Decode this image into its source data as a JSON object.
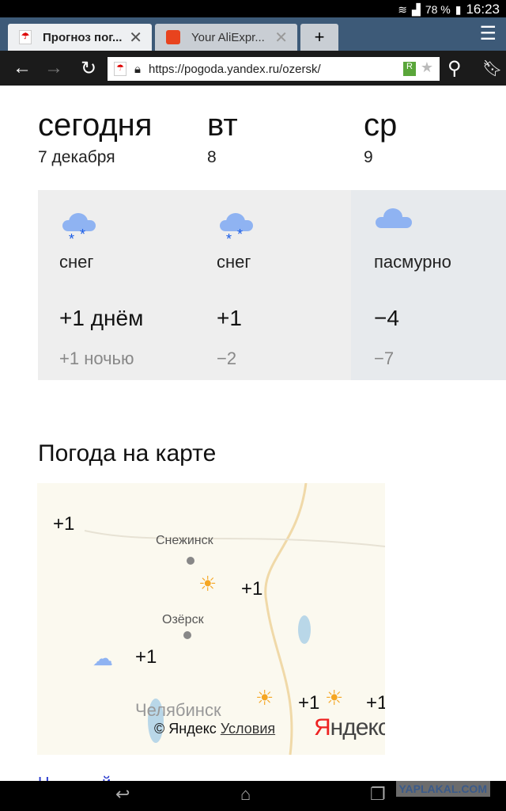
{
  "status": {
    "battery": "78 %",
    "time": "16:23"
  },
  "browser": {
    "tabs": [
      {
        "title": "Прогноз пог...",
        "active": true
      },
      {
        "title": "Your AliExpr...",
        "active": false
      }
    ],
    "new_tab": "+",
    "url": "https://pogoda.yandex.ru/ozersk/"
  },
  "forecast": [
    {
      "day": "сегодня",
      "date": "7 декабря",
      "icon": "snow-cloud-icon",
      "condition": "снег",
      "day_temp": "+1 днём",
      "night_temp": "+1 ночью"
    },
    {
      "day": "вт",
      "date": "8",
      "icon": "snow-cloud-icon",
      "condition": "снег",
      "day_temp": "+1",
      "night_temp": "−2"
    },
    {
      "day": "ср",
      "date": "9",
      "icon": "cloud-icon",
      "condition": "пасмурно",
      "day_temp": "−4",
      "night_temp": "−7"
    }
  ],
  "map": {
    "title": "Погода на карте",
    "cities": [
      "Снежинск",
      "Озёрск",
      "Челябинск"
    ],
    "temps": [
      "+1",
      "+1",
      "+1",
      "+1",
      "+1"
    ],
    "copyright": "© Яндекс",
    "terms": "Условия",
    "logo": "Яндекс"
  },
  "watermark": "YAPLAKAL.COM"
}
